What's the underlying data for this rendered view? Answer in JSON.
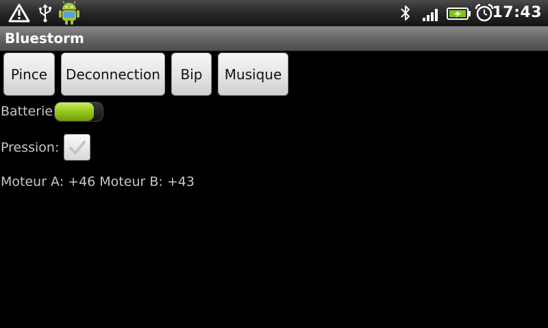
{
  "status_bar": {
    "time": "17:43",
    "icons": [
      "warning-icon",
      "usb-icon",
      "android-icon",
      "bluetooth-icon",
      "signal-icon",
      "battery-charging-icon",
      "alarm-icon"
    ]
  },
  "app": {
    "title": "Bluestorm"
  },
  "buttons": {
    "pince": "Pince",
    "deconnection": "Deconnection",
    "bip": "Bip",
    "musique": "Musique"
  },
  "battery": {
    "label": "Batterie:",
    "level": 0.82,
    "color": "#9acb1c"
  },
  "pressure": {
    "label": "Pression:",
    "checked": true
  },
  "motors": {
    "text": "Moteur A: +46 Moteur B: +43"
  }
}
